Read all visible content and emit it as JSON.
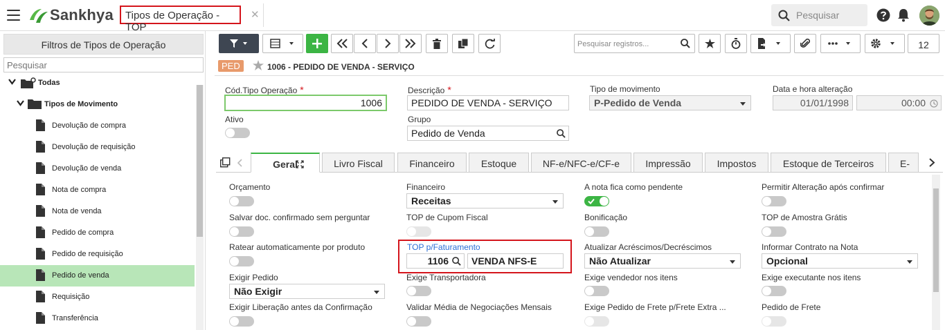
{
  "topbar": {
    "logo_text": "Sankhya",
    "tab_title": "Tipos de Operação - TOP",
    "close_glyph": "✕",
    "search_placeholder": "Pesquisar"
  },
  "left_panel": {
    "title": "Filtros de Tipos de Operação",
    "search_placeholder": "Pesquisar",
    "tree": [
      {
        "label": "Todas",
        "level": 0,
        "type": "root"
      },
      {
        "label": "Tipos de Movimento",
        "level": 1,
        "type": "folder"
      },
      {
        "label": "Devolução de compra",
        "level": 2,
        "type": "doc"
      },
      {
        "label": "Devolução de requisição",
        "level": 2,
        "type": "doc"
      },
      {
        "label": "Devolução de venda",
        "level": 2,
        "type": "doc"
      },
      {
        "label": "Nota de compra",
        "level": 2,
        "type": "doc"
      },
      {
        "label": "Nota de venda",
        "level": 2,
        "type": "doc"
      },
      {
        "label": "Pedido de compra",
        "level": 2,
        "type": "doc"
      },
      {
        "label": "Pedido de requisição",
        "level": 2,
        "type": "doc"
      },
      {
        "label": "Pedido de venda",
        "level": 2,
        "type": "doc",
        "selected": true
      },
      {
        "label": "Requisição",
        "level": 2,
        "type": "doc"
      },
      {
        "label": "Transferência",
        "level": 2,
        "type": "doc"
      }
    ]
  },
  "toolbar": {
    "search_placeholder": "Pesquisar registros...",
    "page_size": "12"
  },
  "form": {
    "badge": "PED",
    "title": "1006 - PEDIDO DE VENDA - SERVIÇO",
    "cod_label": "Cód.Tipo Operação",
    "cod_value": "1006",
    "descricao_label": "Descrição",
    "descricao_value": "PEDIDO DE VENDA - SERVIÇO",
    "tipo_mov_label": "Tipo de movimento",
    "tipo_mov_value": "P-Pedido de Venda",
    "data_label": "Data e hora alteração",
    "data_value": "01/01/1998",
    "hora_value": "00:00",
    "ativo_label": "Ativo",
    "grupo_label": "Grupo",
    "grupo_value": "Pedido de Venda",
    "required_mark": "*"
  },
  "tabs": [
    "Geral",
    "Livro Fiscal",
    "Financeiro",
    "Estoque",
    "NF-e/NFC-e/CF-e",
    "Impressão",
    "Impostos",
    "Estoque de Terceiros",
    "E-ma"
  ],
  "geral": {
    "orcamento": "Orçamento",
    "financeiro": "Financeiro",
    "financeiro_value": "Receitas",
    "nota_pendente": "A nota fica como pendente",
    "permitir_alteracao": "Permitir Alteração após confirmar",
    "salvar_doc": "Salvar doc. confirmado sem perguntar",
    "top_cupom": "TOP de Cupom Fiscal",
    "bonificacao": "Bonificação",
    "top_amostra": "TOP de Amostra Grátis",
    "ratear": "Ratear automaticamente por produto",
    "top_faturamento": "TOP p/Faturamento",
    "top_fat_code": "1106",
    "top_fat_desc": "VENDA NFS-E",
    "atualizar_acresc": "Atualizar Acréscimos/Decréscimos",
    "atualizar_value": "Não Atualizar",
    "informar_contrato": "Informar Contrato na Nota",
    "informar_value": "Opcional",
    "exigir_pedido": "Exigir Pedido",
    "exigir_pedido_value": "Não Exigir",
    "exige_transp": "Exige Transportadora",
    "exige_vendedor": "Exige vendedor nos itens",
    "exige_executante": "Exige executante nos itens",
    "exigir_liberacao": "Exigir Liberação antes da Confirmação",
    "validar_media": "Validar Média de Negociações Mensais",
    "exige_frete": "Exige Pedido de Frete p/Frete Extra ...",
    "pedido_frete": "Pedido de Frete"
  }
}
